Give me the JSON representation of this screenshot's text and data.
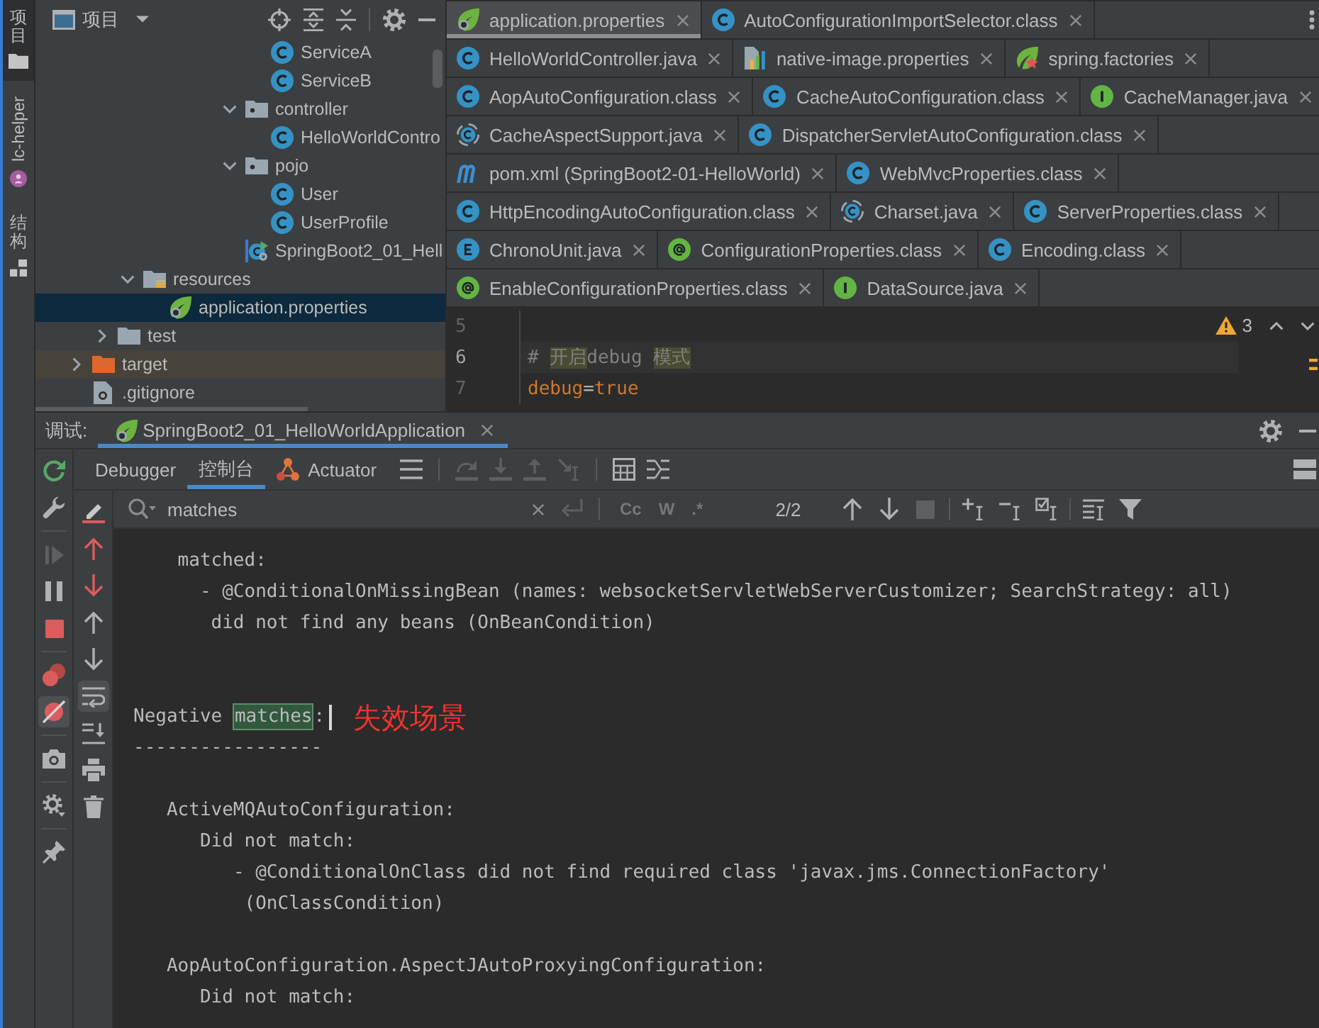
{
  "tool_stripe": [
    {
      "label": "项目",
      "kind": "folder",
      "selected": true
    },
    {
      "label": "lc-helper",
      "kind": "badge",
      "selected": false
    },
    {
      "label": "结构",
      "kind": "blocks",
      "selected": false
    }
  ],
  "project": {
    "title": "项目",
    "tree": [
      {
        "children": [
          {
            "children": [
              {
                "children": [
                  {
                    "children": [
                      {
                        "children": [
                          {
                            "children": [
                              {
                                "children": [
                                  {
                                    "label": "ServiceA",
                                    "kind": "class",
                                    "selected": false
                                  },
                                  {
                                    "label": "ServiceB",
                                    "kind": "class",
                                    "selected": false
                                  }
                                ]
                              },
                              {
                                "label": "controller",
                                "kind": "package",
                                "expanded": true,
                                "selected": false,
                                "children": [
                                  {
                                    "label": "HelloWorldContro",
                                    "kind": "class",
                                    "selected": false
                                  }
                                ]
                              },
                              {
                                "label": "pojo",
                                "kind": "package",
                                "expanded": true,
                                "selected": false,
                                "children": [
                                  {
                                    "label": "User",
                                    "kind": "class",
                                    "selected": false
                                  },
                                  {
                                    "label": "UserProfile",
                                    "kind": "class",
                                    "selected": false
                                  }
                                ]
                              },
                              {
                                "label": "SpringBoot2_01_Hell",
                                "kind": "app-class",
                                "selected": false
                              }
                            ]
                          }
                        ]
                      }
                    ]
                  }
                ]
              },
              {
                "label": "resources",
                "kind": "resources",
                "expanded": true,
                "selected": false,
                "children": [
                  {
                    "label": "application.properties",
                    "kind": "spring-properties",
                    "selected": true
                  }
                ]
              }
            ]
          },
          {
            "label": "test",
            "kind": "folder",
            "expanded": false,
            "selected": false
          }
        ]
      },
      {
        "label": "target",
        "kind": "excluded",
        "expanded": false,
        "selected": false
      },
      {
        "label": ".gitignore",
        "kind": "file",
        "selected": false
      }
    ]
  },
  "editor": {
    "tab_rows": [
      [
        {
          "label": "application.properties",
          "kind": "spring-properties",
          "selected": true
        },
        {
          "label": "AutoConfigurationImportSelector.class",
          "kind": "class",
          "selected": false
        }
      ],
      [
        {
          "label": "HelloWorldController.java",
          "kind": "class",
          "selected": false
        },
        {
          "label": "native-image.properties",
          "kind": "native-properties",
          "selected": false
        },
        {
          "label": "spring.factories",
          "kind": "spring-factories",
          "selected": false
        }
      ],
      [
        {
          "label": "AopAutoConfiguration.class",
          "kind": "class",
          "selected": false
        },
        {
          "label": "CacheAutoConfiguration.class",
          "kind": "class",
          "selected": false
        },
        {
          "label": "CacheManager.java",
          "kind": "interface",
          "selected": false
        }
      ],
      [
        {
          "label": "CacheAspectSupport.java",
          "kind": "abstract-class",
          "selected": false
        },
        {
          "label": "DispatcherServletAutoConfiguration.class",
          "kind": "class",
          "selected": false
        }
      ],
      [
        {
          "label": "pom.xml (SpringBoot2-01-HelloWorld)",
          "kind": "maven",
          "selected": false
        },
        {
          "label": "WebMvcProperties.class",
          "kind": "class",
          "selected": false
        }
      ],
      [
        {
          "label": "HttpEncodingAutoConfiguration.class",
          "kind": "class",
          "selected": false
        },
        {
          "label": "Charset.java",
          "kind": "abstract-class",
          "selected": false
        },
        {
          "label": "ServerProperties.class",
          "kind": "class",
          "selected": false
        }
      ],
      [
        {
          "label": "ChronoUnit.java",
          "kind": "enum",
          "selected": false
        },
        {
          "label": "ConfigurationProperties.class",
          "kind": "annotation",
          "selected": false
        },
        {
          "label": "Encoding.class",
          "kind": "class",
          "selected": false
        }
      ],
      [
        {
          "label": "EnableConfigurationProperties.class",
          "kind": "annotation",
          "selected": false
        },
        {
          "label": "DataSource.java",
          "kind": "interface",
          "selected": false
        }
      ]
    ],
    "warnings": "3",
    "lines": [
      {
        "number": "5",
        "current": false
      },
      {
        "number": "6",
        "current": true,
        "tokens": [
          {
            "text": "# ",
            "kind": "comment",
            "flagged": false
          },
          {
            "text": "开启",
            "kind": "comment",
            "flagged": true
          },
          {
            "text": "debug ",
            "kind": "comment",
            "flagged": false
          },
          {
            "text": "模式",
            "kind": "comment",
            "flagged": true
          }
        ]
      },
      {
        "number": "7",
        "current": false,
        "tokens": [
          {
            "text": "debug",
            "kind": "key",
            "flagged": false
          },
          {
            "text": "=",
            "kind": "operator",
            "flagged": false
          },
          {
            "text": "true",
            "kind": "value",
            "flagged": false
          }
        ]
      }
    ]
  },
  "debug": {
    "title": "调试:",
    "session_tabs": [
      {
        "label": "SpringBoot2_01_HelloWorldApplication",
        "selected": true
      }
    ],
    "side_toolbar": [
      [
        {
          "kind": "rerun",
          "disabled": false,
          "on": false
        },
        {
          "kind": "wrench",
          "disabled": false,
          "on": false
        }
      ],
      [
        {
          "kind": "resume",
          "disabled": true,
          "on": false
        },
        {
          "kind": "pause",
          "disabled": false,
          "on": false
        },
        {
          "kind": "stop",
          "disabled": false,
          "on": false
        }
      ],
      [
        {
          "kind": "breakpoints",
          "disabled": false,
          "on": false
        },
        {
          "kind": "mute-breakpoints",
          "disabled": false,
          "on": true
        }
      ],
      [
        {
          "kind": "camera",
          "disabled": false,
          "on": false
        }
      ],
      [
        {
          "kind": "settings",
          "disabled": false,
          "on": false
        }
      ],
      [
        {
          "kind": "pin",
          "disabled": false,
          "on": false
        }
      ]
    ],
    "tabs": [
      {
        "label": "Debugger",
        "kind": "plain",
        "selected": false
      },
      {
        "label": "控制台",
        "kind": "plain",
        "selected": true
      },
      {
        "label": "Actuator",
        "kind": "graph",
        "selected": false
      }
    ],
    "tab_toolbar": [
      [
        {
          "kind": "list",
          "disabled": false
        }
      ],
      [
        {
          "kind": "step-over",
          "disabled": true
        },
        {
          "kind": "step-into",
          "disabled": true
        },
        {
          "kind": "step-out",
          "disabled": true
        },
        {
          "kind": "run-to-cursor",
          "disabled": true
        }
      ],
      [
        {
          "kind": "table",
          "disabled": false
        },
        {
          "kind": "columns",
          "disabled": false
        }
      ]
    ],
    "console_toolbar": [
      {
        "kind": "pencil",
        "on": false
      },
      {
        "kind": "prev-error",
        "on": false
      },
      {
        "kind": "next-error",
        "on": false
      },
      {
        "kind": "up",
        "on": false
      },
      {
        "kind": "down",
        "on": false
      },
      {
        "kind": "soft-wrap",
        "on": true
      },
      {
        "kind": "scroll-end",
        "on": false
      },
      {
        "kind": "print",
        "on": false
      },
      {
        "kind": "trash",
        "on": false
      }
    ],
    "search": {
      "value": "matches",
      "field_buttons": [
        {
          "kind": "clear",
          "disabled": false
        },
        {
          "kind": "newline",
          "disabled": true
        }
      ],
      "options": [
        {
          "label": "Cc",
          "selected": false
        },
        {
          "label": "W",
          "selected": false
        },
        {
          "label": ".*",
          "selected": false
        }
      ],
      "count": "2/2",
      "toolbar": [
        [
          {
            "kind": "up",
            "disabled": false
          },
          {
            "kind": "down",
            "disabled": false
          },
          {
            "kind": "square",
            "disabled": true
          }
        ],
        [
          {
            "kind": "add-occurrence",
            "disabled": false
          },
          {
            "kind": "remove-occurrence",
            "disabled": false
          },
          {
            "kind": "select-occurrences",
            "disabled": false
          }
        ],
        [
          {
            "kind": "multiline",
            "disabled": false
          },
          {
            "kind": "filter",
            "disabled": false
          }
        ]
      ]
    },
    "console": {
      "lines": [
        {
          "kind": "text",
          "text": "    matched:",
          "cursor": false
        },
        {
          "kind": "text",
          "text": "      - @ConditionalOnMissingBean (names: websocketServletWebServerCustomizer; SearchStrategy: all)",
          "cursor": false
        },
        {
          "kind": "text",
          "text": "       did not find any beans (OnBeanCondition)",
          "cursor": false
        },
        {
          "kind": "blank"
        },
        {
          "kind": "blank"
        },
        {
          "kind": "text",
          "segments": [
            {
              "text": "Negative ",
              "highlighted": false
            },
            {
              "text": "matches",
              "highlighted": true
            },
            {
              "text": ":",
              "highlighted": false
            }
          ],
          "cursor": true,
          "note": "失效场景"
        },
        {
          "kind": "text",
          "text": "-----------------",
          "cursor": false
        },
        {
          "kind": "blank"
        },
        {
          "kind": "text",
          "text": "   ActiveMQAutoConfiguration:",
          "cursor": false
        },
        {
          "kind": "text",
          "text": "      Did not match:",
          "cursor": false
        },
        {
          "kind": "text",
          "text": "         - @ConditionalOnClass did not find required class 'javax.jms.ConnectionFactory'",
          "cursor": false
        },
        {
          "kind": "text",
          "text": "          (OnClassCondition)",
          "cursor": false
        },
        {
          "kind": "blank"
        },
        {
          "kind": "text",
          "text": "   AopAutoConfiguration.AspectJAutoProxyingConfiguration:",
          "cursor": false
        },
        {
          "kind": "text",
          "text": "      Did not match:",
          "cursor": false
        }
      ]
    }
  }
}
